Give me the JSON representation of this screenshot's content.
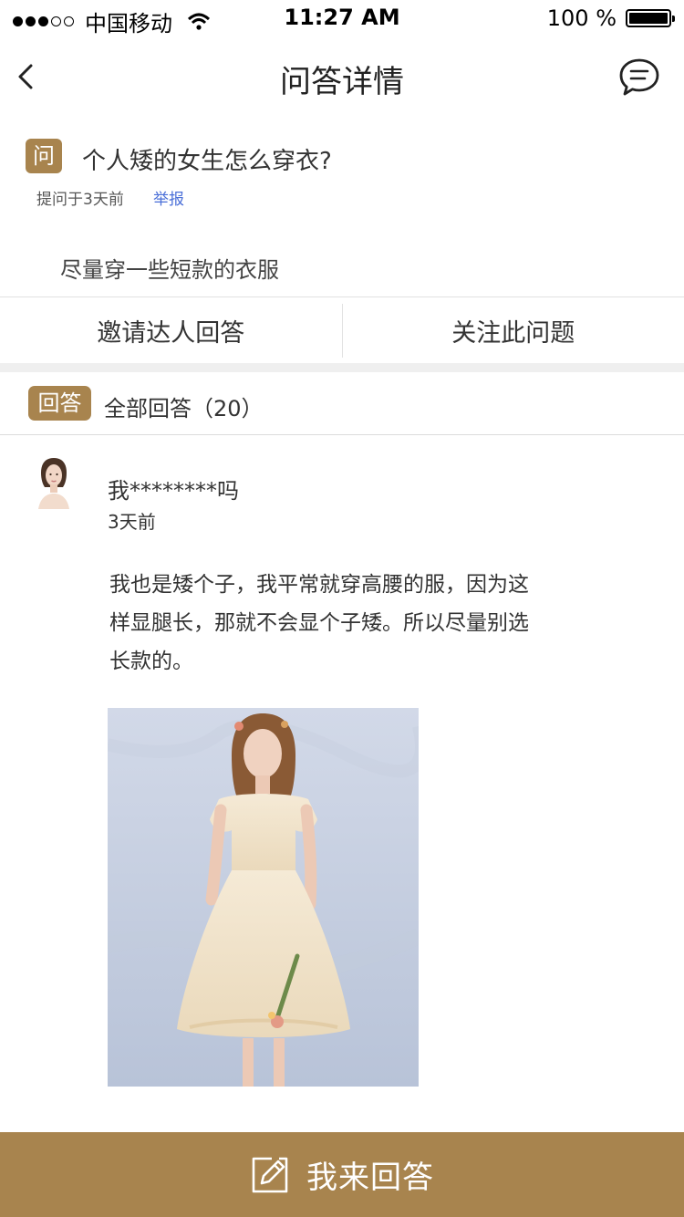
{
  "status_bar": {
    "carrier": "中国移动",
    "time": "11:27 AM",
    "battery": "100 %",
    "signal_bars": 3
  },
  "nav": {
    "title": "问答详情",
    "back_icon": "chevron-left-icon",
    "message_icon": "chat-bubble-icon"
  },
  "question": {
    "badge": "问",
    "title": "个人矮的女生怎么穿衣?",
    "meta": "提问于3天前",
    "report_label": "举报",
    "description": "尽量穿一些短款的衣服"
  },
  "actions": {
    "invite_label": "邀请达人回答",
    "follow_label": "关注此问题"
  },
  "answers_header": {
    "badge": "回答",
    "count_label": "全部回答（20）"
  },
  "answer": {
    "username": "我********吗",
    "time": "3天前",
    "text": "我也是矮个子，我平常就穿高腰的服，因为这样显腿长，那就不会显个子矮。所以尽量别选长款的。"
  },
  "footer": {
    "label": "我来回答",
    "icon": "edit-icon"
  },
  "colors": {
    "accent": "#a8844e",
    "link": "#4a6fd8"
  }
}
